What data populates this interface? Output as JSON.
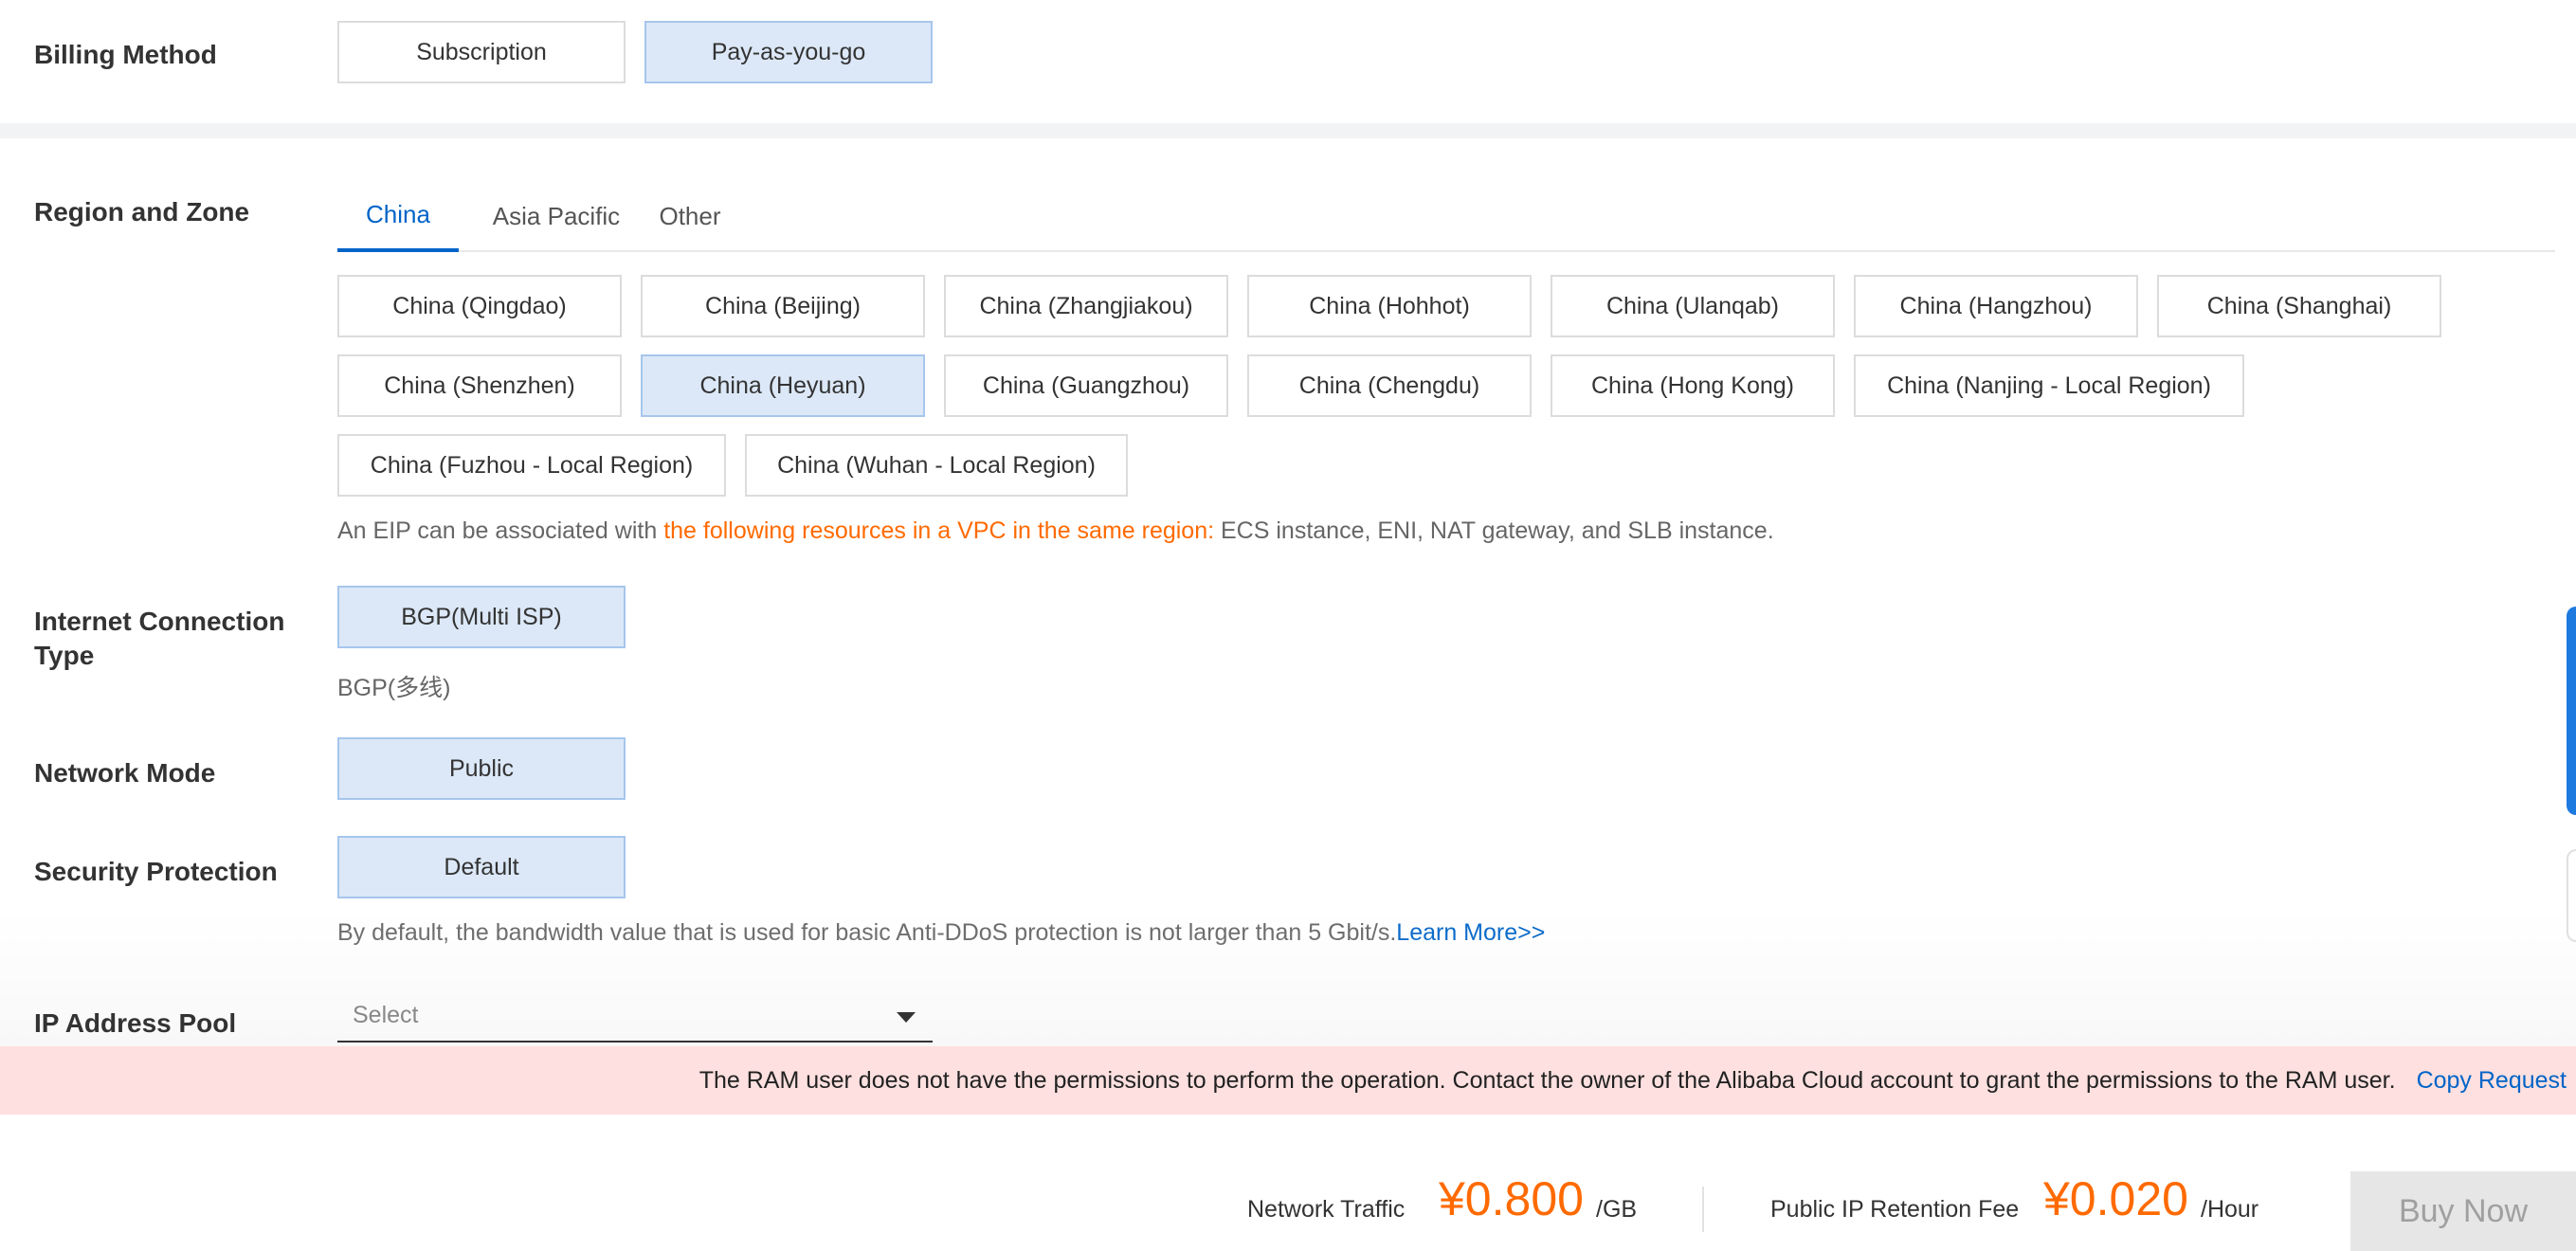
{
  "billing": {
    "label": "Billing Method",
    "options": [
      "Subscription",
      "Pay-as-you-go"
    ],
    "selected": "Pay-as-you-go"
  },
  "region": {
    "label": "Region and Zone",
    "tabs": [
      "China",
      "Asia Pacific",
      "Other"
    ],
    "active_tab": "China",
    "zones": [
      "China (Qingdao)",
      "China (Beijing)",
      "China (Zhangjiakou)",
      "China (Hohhot)",
      "China (Ulanqab)",
      "China (Hangzhou)",
      "China (Shanghai)",
      "China (Shenzhen)",
      "China (Heyuan)",
      "China (Guangzhou)",
      "China (Chengdu)",
      "China (Hong Kong)",
      "China (Nanjing - Local Region)",
      "China (Fuzhou - Local Region)",
      "China (Wuhan - Local Region)"
    ],
    "selected_zone": "China (Heyuan)",
    "note_prefix": "An EIP can be associated with ",
    "note_highlight": "the following resources in a VPC in the same region:",
    "note_suffix": " ECS instance, ENI, NAT gateway, and SLB instance."
  },
  "connection": {
    "label": "Internet Connection Type",
    "option": "BGP(Multi ISP)",
    "note": "BGP(多线)"
  },
  "network_mode": {
    "label": "Network Mode",
    "option": "Public"
  },
  "security": {
    "label": "Security Protection",
    "option": "Default",
    "note": "By default, the bandwidth value that is used for basic Anti-DDoS protection is not larger than 5 Gbit/s.",
    "learn_more": "Learn More>>"
  },
  "ip_pool": {
    "label": "IP Address Pool",
    "placeholder": "Select"
  },
  "banner": {
    "message": "The RAM user does not have the permissions to perform the operation. Contact the owner of the Alibaba Cloud account to grant the permissions to the RAM user.",
    "copy_link": "Copy Request"
  },
  "footer": {
    "traffic_label": "Network Traffic",
    "traffic_price": "¥0.800",
    "traffic_unit": "/GB",
    "retention_label": "Public IP Retention Fee",
    "retention_price": "¥0.020",
    "retention_unit": "/Hour",
    "buy_label": "Buy Now"
  },
  "colors": {
    "accent": "#0064c8",
    "price": "#ff6a00",
    "selected_bg": "#dce8f7",
    "banner_bg": "#fde0df"
  }
}
